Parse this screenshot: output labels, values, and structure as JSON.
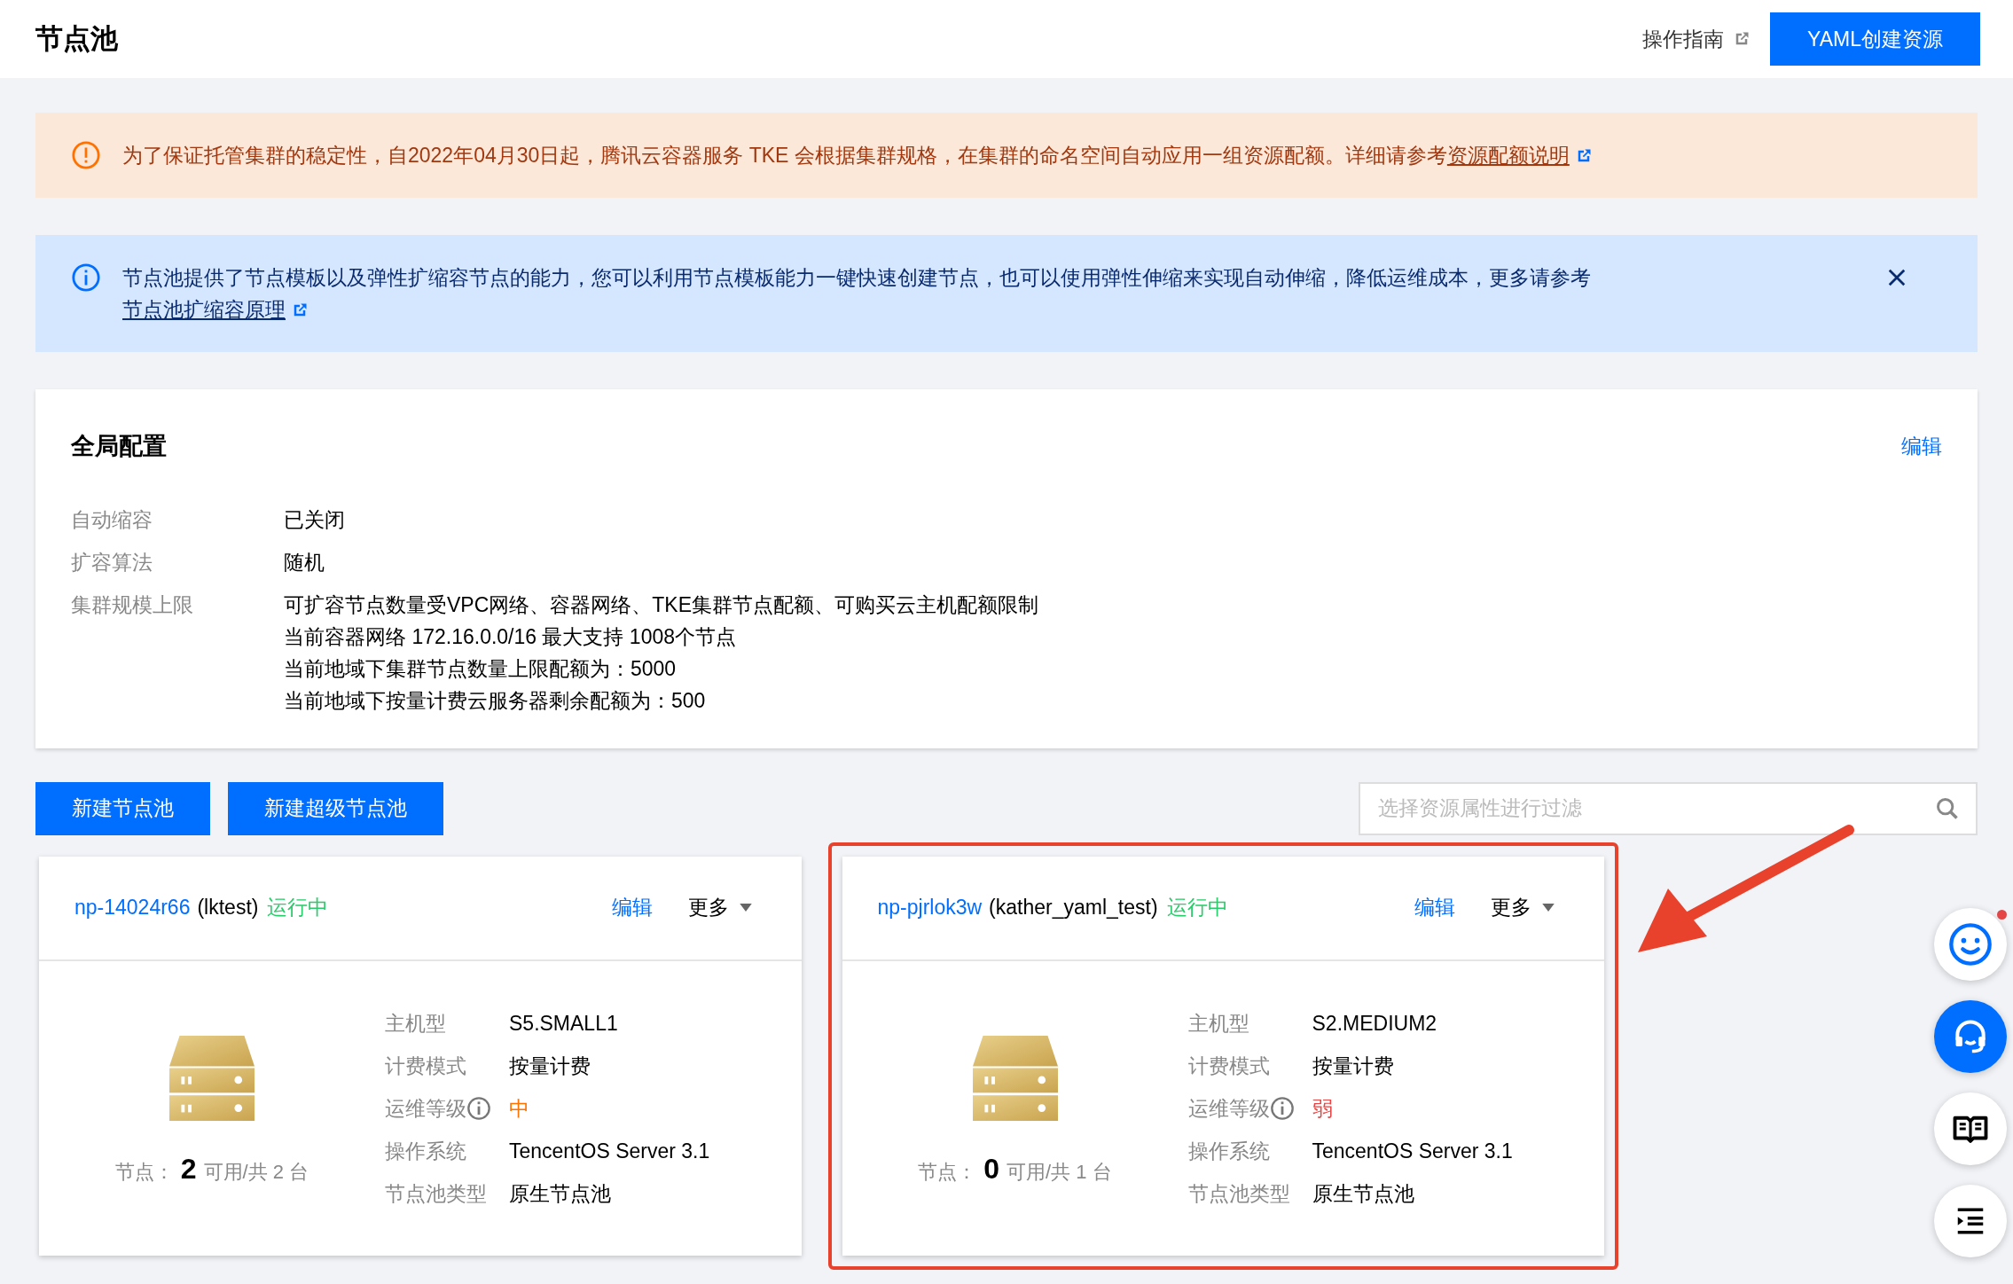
{
  "header": {
    "title": "节点池",
    "guide_link": "操作指南",
    "create_button": "YAML创建资源"
  },
  "alerts": [
    {
      "kind": "warning",
      "text": "为了保证托管集群的稳定性，自2022年04月30日起，腾讯云容器服务 TKE 会根据集群规格，在集群的命名空间自动应用一组资源配额。详细请参考",
      "link": "资源配额说明",
      "closable": false
    },
    {
      "kind": "info",
      "text": "节点池提供了节点模板以及弹性扩缩容节点的能力，您可以利用节点模板能力一键快速创建节点，也可以使用弹性伸缩来实现自动伸缩，降低运维成本，更多请参考",
      "link": "节点池扩缩容原理",
      "closable": true
    }
  ],
  "global_config": {
    "title": "全局配置",
    "edit": "编辑",
    "rows": [
      {
        "label": "自动缩容",
        "lines": [
          "已关闭"
        ]
      },
      {
        "label": "扩容算法",
        "lines": [
          "随机"
        ]
      },
      {
        "label": "集群规模上限",
        "lines": [
          "可扩容节点数量受VPC网络、容器网络、TKE集群节点配额、可购买云主机配额限制",
          "当前容器网络 172.16.0.0/16 最大支持 1008个节点",
          "当前地域下集群节点数量上限配额为：5000",
          "当前地域下按量计费云服务器剩余配额为：500"
        ]
      }
    ]
  },
  "actions": [
    "新建节点池",
    "新建超级节点池"
  ],
  "filter": {
    "placeholder": "选择资源属性进行过滤"
  },
  "node_pools": [
    {
      "id": "np-14024r66",
      "name": "(lktest)",
      "status": "运行中",
      "edit": "编辑",
      "more": "更多",
      "nodes_label": "节点：",
      "available": "2",
      "total": "可用/共 2 台",
      "highlighted": false,
      "specs": [
        {
          "kind": "text",
          "label": "主机型",
          "value": "S5.SMALL1"
        },
        {
          "kind": "text",
          "label": "计费模式",
          "value": "按量计费"
        },
        {
          "kind": "level",
          "label": "运维等级",
          "value": "中",
          "color": "#ff7200"
        },
        {
          "kind": "text",
          "label": "操作系统",
          "value": "TencentOS Server 3.1"
        },
        {
          "kind": "text",
          "label": "节点池类型",
          "value": "原生节点池"
        }
      ]
    },
    {
      "id": "np-pjrlok3w",
      "name": "(kather_yaml_test)",
      "status": "运行中",
      "edit": "编辑",
      "more": "更多",
      "nodes_label": "节点：",
      "available": "0",
      "total": "可用/共 1 台",
      "highlighted": true,
      "specs": [
        {
          "kind": "text",
          "label": "主机型",
          "value": "S2.MEDIUM2"
        },
        {
          "kind": "text",
          "label": "计费模式",
          "value": "按量计费"
        },
        {
          "kind": "level",
          "label": "运维等级",
          "value": "弱",
          "color": "#e54545"
        },
        {
          "kind": "text",
          "label": "操作系统",
          "value": "TencentOS Server 3.1"
        },
        {
          "kind": "text",
          "label": "节点池类型",
          "value": "原生节点池"
        }
      ]
    }
  ]
}
